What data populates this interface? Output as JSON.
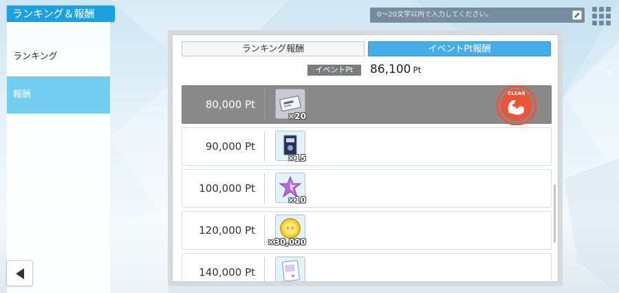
{
  "header": {
    "title": "ランキング＆報酬",
    "search_placeholder": "0～20文字以内で入力してください。"
  },
  "sidebar": {
    "items": [
      {
        "label": "ランキング",
        "active": false
      },
      {
        "label": "報酬",
        "active": true
      }
    ]
  },
  "tabs": {
    "ranking_label": "ランキング報酬",
    "event_label": "イベントPt報酬",
    "selected": "event"
  },
  "points": {
    "label": "イベントPt",
    "value": "86,100",
    "unit": "Pt"
  },
  "rewards": [
    {
      "points": "80,000 Pt",
      "item_icon": "ticket-icon",
      "quantity": "×20",
      "claimed": true,
      "badge": "CLEAR"
    },
    {
      "points": "90,000 Pt",
      "item_icon": "book-icon",
      "quantity": "×15",
      "claimed": false
    },
    {
      "points": "100,000 Pt",
      "item_icon": "purple-crystal-icon",
      "quantity": "×10",
      "claimed": false
    },
    {
      "points": "120,000 Pt",
      "item_icon": "gold-coin-icon",
      "quantity": "×30,000",
      "claimed": false
    },
    {
      "points": "140,000 Pt",
      "item_icon": "card-icon",
      "quantity": "",
      "claimed": false
    }
  ],
  "colors": {
    "accent_blue": "#1da1de",
    "tab_active": "#45aee8",
    "sidebar_active": "#73cdf1",
    "claimed_row": "#8a8a8a",
    "clear_badge": "#e8553a"
  }
}
